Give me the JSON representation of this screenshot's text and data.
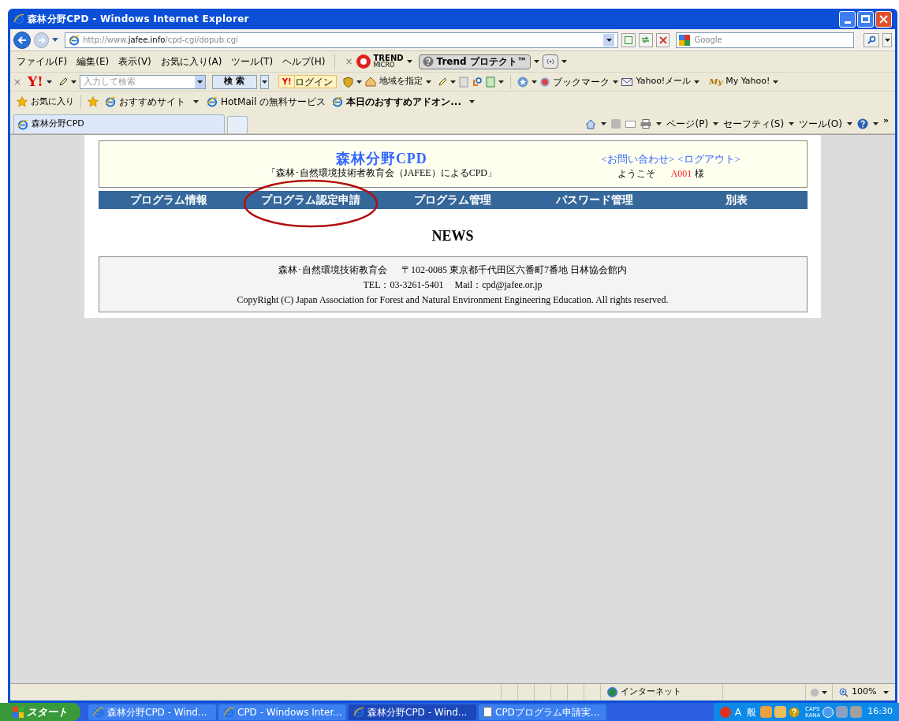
{
  "window": {
    "title": "森林分野CPD - Windows Internet Explorer"
  },
  "address_bar": {
    "url_prefix": "http://www.",
    "url_domain": "jafee.info",
    "url_path": "/cpd-cgi/dopub.cgi",
    "search_placeholder": "Google"
  },
  "menu_bar": {
    "items": [
      "ファイル(F)",
      "編集(E)",
      "表示(V)",
      "お気に入り(A)",
      "ツール(T)",
      "ヘルプ(H)"
    ],
    "close": "×",
    "trend_logo": "TREND",
    "trend_logo_sub": "MICRO",
    "trend_button": "Trend プロテクト™"
  },
  "yahoo_toolbar": {
    "close": "×",
    "logo": "Y!",
    "search_placeholder": "入力して検索",
    "search_button": "検 索",
    "login_logo": "Y!",
    "login": "ログイン",
    "region": "地域を指定",
    "bookmark": "ブックマーク",
    "mail": "Yahoo!メール",
    "my_logo": "My",
    "my_yahoo": "My Yahoo!"
  },
  "favorites_bar": {
    "favorites": "お気に入り",
    "items": [
      {
        "label": "おすすめサイト",
        "bold": false,
        "dropdown": true
      },
      {
        "label": "HotMail の無料サービス",
        "bold": false,
        "dropdown": false
      },
      {
        "label": "本日のおすすめアドオン...",
        "bold": true,
        "dropdown": true
      }
    ]
  },
  "tabs": [
    {
      "label": "森林分野CPD",
      "selected": true
    }
  ],
  "command_bar": {
    "items": [
      "ページ(P)",
      "セーフティ(S)",
      "ツール(O)"
    ],
    "more": "»"
  },
  "page": {
    "site_title": "森林分野CPD",
    "subtitle": "「森林･自然環境技術者教育会（JAFEE）によるCPD」",
    "links": [
      "<お問い合わせ>",
      "<ログアウト>"
    ],
    "welcome": "ようこそ",
    "user_id": "A001",
    "honorific": "様",
    "nav": [
      {
        "label": "プログラム情報",
        "circled": false
      },
      {
        "label": "プログラム認定申請",
        "circled": true
      },
      {
        "label": "プログラム管理",
        "circled": false
      },
      {
        "label": "パスワード管理",
        "circled": false
      },
      {
        "label": "別表",
        "circled": false
      }
    ],
    "news_heading": "NEWS",
    "footer": {
      "org": "森林･自然環境技術教育会",
      "address": "〒102-0085 東京都千代田区六番町7番地 日林協会館内",
      "tel": "TEL：03-3261-5401",
      "mail": "Mail：cpd@jafee.or.jp",
      "copyright": "CopyRight (C) Japan Association for Forest and Natural Environment Engineering Education. All rights reserved."
    }
  },
  "status_bar": {
    "zone": "インターネット",
    "zoom": "100%"
  },
  "taskbar": {
    "start": "スタート",
    "buttons": [
      {
        "label": "森林分野CPD - Wind...",
        "selected": false,
        "kind": "browser"
      },
      {
        "label": "CPD - Windows Inter...",
        "selected": false,
        "kind": "browser"
      },
      {
        "label": "森林分野CPD - Wind...",
        "selected": true,
        "kind": "browser"
      },
      {
        "label": "CPDプログラム申請実...",
        "selected": false,
        "kind": "document"
      }
    ],
    "ime": [
      "A",
      "般"
    ],
    "caps": "CAPS",
    "kana": "KANA",
    "clock": "16:30"
  }
}
